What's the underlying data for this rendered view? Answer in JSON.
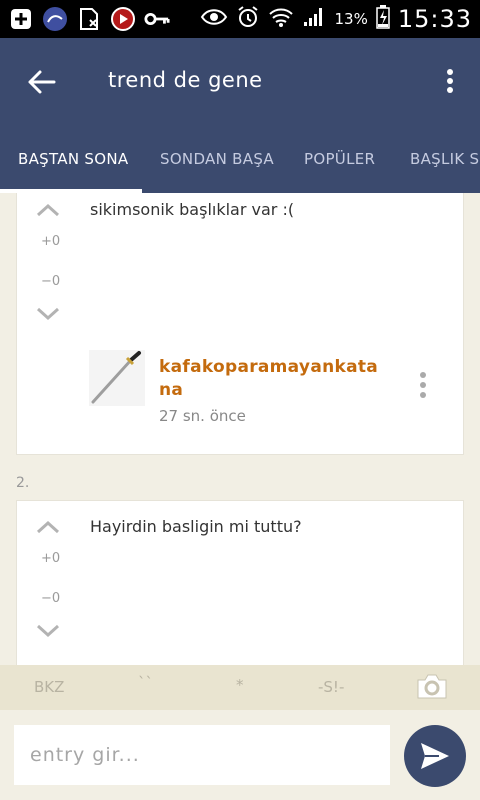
{
  "status_bar": {
    "battery": "13%",
    "time": "15:33",
    "left_icons": [
      "plus-box-icon",
      "app-icon",
      "sim-off-icon",
      "video-player-icon",
      "key-icon"
    ],
    "right_icons": [
      "eye-icon",
      "alarm-icon",
      "wifi-icon",
      "signal-icon",
      "battery-charging-icon"
    ]
  },
  "appbar": {
    "title": "trend de gene",
    "back_icon": "arrow-back-icon",
    "menu_icon": "more-vertical-icon",
    "color": "#3b4a6e"
  },
  "tabs": [
    {
      "label": "BAŞTAN SONA",
      "active": true
    },
    {
      "label": "SONDAN BAŞA",
      "active": false
    },
    {
      "label": "POPÜLER",
      "active": false
    },
    {
      "label": "BAŞLIK S",
      "active": false
    }
  ],
  "entries": [
    {
      "text": "sikimsonik başlıklar var :(",
      "up_count": "+0",
      "down_count": "−0",
      "author_line1": "kafakoparamayankata",
      "author_line2": "na",
      "time": "27 sn. önce"
    },
    {
      "number": "2.",
      "text": "Hayirdin basligin mi tuttu?",
      "up_count": "+0",
      "down_count": "−0"
    }
  ],
  "toolbar": {
    "bkz": "BKZ",
    "backtick": "``",
    "star": "*",
    "spoiler": "-S!-",
    "camera_icon": "camera-icon"
  },
  "input": {
    "placeholder": "entry gir..."
  },
  "colors": {
    "primary": "#3b4a6e",
    "author": "#c46b0e",
    "background": "#f2efe4"
  }
}
